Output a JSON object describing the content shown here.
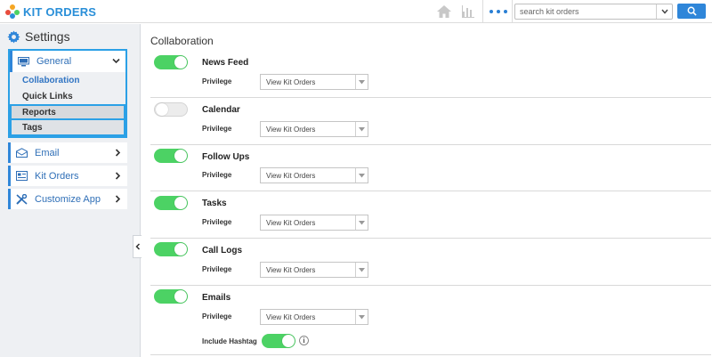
{
  "app": {
    "logo_text": "KIT ORDERS",
    "logo_colors": [
      "#f5a623",
      "#e84c3d",
      "#4cd264",
      "#2a8fd8"
    ]
  },
  "topbar": {
    "search_placeholder": "search kit orders",
    "icons": [
      "home-icon",
      "chart-icon",
      "more-dots-icon",
      "search-icon"
    ]
  },
  "sidebar": {
    "title": "Settings",
    "groups": [
      {
        "label": "General",
        "icon": "monitor-icon",
        "expanded": true,
        "items": [
          {
            "label": "Collaboration",
            "active": true
          },
          {
            "label": "Quick Links"
          },
          {
            "label": "Reports"
          },
          {
            "label": "Tags"
          }
        ]
      },
      {
        "label": "Email",
        "icon": "email-icon"
      },
      {
        "label": "Kit Orders",
        "icon": "kit-orders-icon"
      },
      {
        "label": "Customize App",
        "icon": "tools-icon"
      }
    ]
  },
  "main": {
    "title": "Collaboration",
    "privilege_label": "Privilege",
    "sections": [
      {
        "title": "News Feed",
        "enabled": true,
        "privilege": "View Kit Orders"
      },
      {
        "title": "Calendar",
        "enabled": false,
        "privilege": "View Kit Orders"
      },
      {
        "title": "Follow Ups",
        "enabled": true,
        "privilege": "View Kit Orders"
      },
      {
        "title": "Tasks",
        "enabled": true,
        "privilege": "View Kit Orders"
      },
      {
        "title": "Call Logs",
        "enabled": true,
        "privilege": "View Kit Orders"
      },
      {
        "title": "Emails",
        "enabled": true,
        "privilege": "View Kit Orders",
        "hashtag_label": "Include Hashtag",
        "hashtag_enabled": true
      }
    ]
  },
  "colors": {
    "accent": "#2f86d9",
    "toggle_on": "#4cd264",
    "highlight_border": "#2ba0e6"
  }
}
